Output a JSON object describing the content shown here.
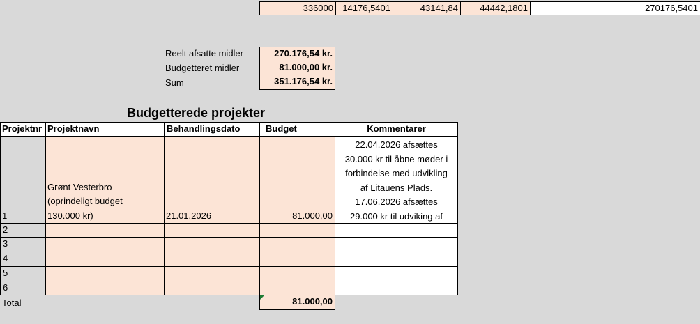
{
  "top_row": {
    "values": [
      "336000",
      "14176,5401",
      "43141,84",
      "44442,1801",
      "",
      "270176,5401"
    ]
  },
  "summary": {
    "rows": [
      {
        "label": "Reelt afsatte midler",
        "value": "270.176,54 kr."
      },
      {
        "label": "Budgetteret midler",
        "value": "81.000,00 kr."
      },
      {
        "label": "Sum",
        "value": "351.176,54 kr."
      }
    ]
  },
  "projects": {
    "title": "Budgetterede projekter",
    "headers": [
      "Projektnr",
      "Projektnavn",
      "Behandlingsdato",
      "Budget",
      "Kommentarer"
    ],
    "row1": {
      "nr": "1",
      "name_lines": [
        "Grønt Vesterbro",
        "(oprindeligt budget",
        "130.000 kr)"
      ],
      "date": "21.01.2026",
      "budget": "81.000,00",
      "comment_lines": [
        "22.04.2026 afsættes",
        "30.000 kr til åbne møder i",
        "forbindelse med udvikling",
        "af Litauens Plads.",
        "17.06.2026 afsættes",
        "29.000 kr til udviking af"
      ]
    },
    "empty_rows": [
      "2",
      "3",
      "4",
      "5",
      "6"
    ],
    "total_label": "Total",
    "total_value": "81.000,00"
  }
}
